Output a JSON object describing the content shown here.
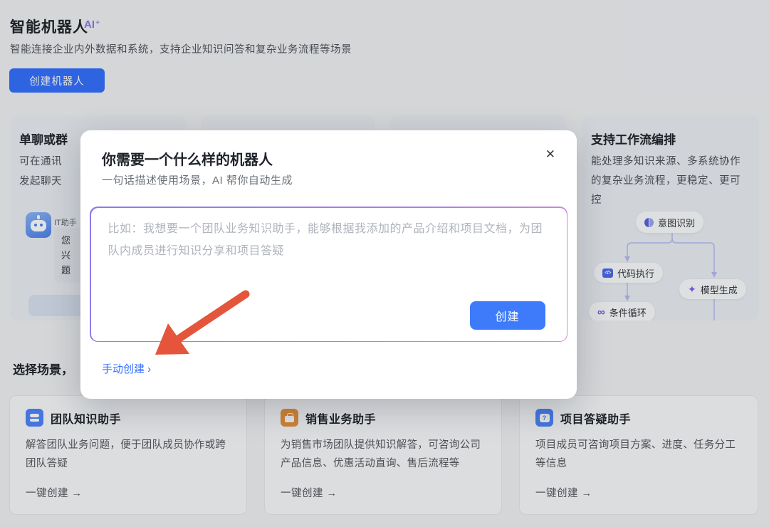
{
  "page": {
    "title": "智能机器人",
    "badge": "AI",
    "badge_star": "✦",
    "subtitle": "智能连接企业内外数据和系统，支持企业知识问答和复杂业务流程等场景",
    "create_button": "创建机器人",
    "scene_section_label": "选择场景，"
  },
  "hero_cards": {
    "chat": {
      "title": "单聊或群",
      "desc_line1": "可在通讯",
      "desc_line2": "发起聊天",
      "bot_name": "IT助手",
      "bubble_line1": "您",
      "bubble_line2": "兴",
      "bubble_line3": "题"
    },
    "workflow": {
      "title": "支持工作流编排",
      "desc": "能处理多知识来源、多系统协作的复杂业务流程，更稳定、更可控",
      "nodes": [
        {
          "label": "意图识别"
        },
        {
          "label": "代码执行",
          "glyph": "</>"
        },
        {
          "label": "模型生成",
          "glyph": "✦"
        },
        {
          "label": "条件循环",
          "glyph": "∞"
        }
      ]
    }
  },
  "modal": {
    "title": "你需要一个什么样的机器人",
    "subtitle": "一句话描述使用场景，AI 帮你自动生成",
    "close_icon": "✕",
    "input_placeholder": "比如：我想要一个团队业务知识助手，能够根据我添加的产品介绍和项目文档，为团队内成员进行知识分享和项目答疑",
    "create_button": "创建",
    "manual_create_link": "手动创建 ›"
  },
  "scene_cards": [
    {
      "title": "团队知识助手",
      "desc": "解答团队业务问题，便于团队成员协作或跨团队答疑",
      "action": "一键创建 →"
    },
    {
      "title": "销售业务助手",
      "desc": "为销售市场团队提供知识解答，可咨询公司产品信息、优惠活动直询、售后流程等",
      "action": "一键创建 →"
    },
    {
      "title": "项目答疑助手",
      "desc": "项目成员可咨询项目方案、进度、任务分工等信息",
      "action": "一键创建 →"
    }
  ],
  "icons": {
    "question_glyph": "?"
  },
  "colors": {
    "primary_blue": "#3370FF",
    "badge_purple": "#9373EE",
    "arrow_red": "#E4553C",
    "scene_icon_blue": "#4E83FD",
    "scene_icon_orange": "#E8923A"
  }
}
